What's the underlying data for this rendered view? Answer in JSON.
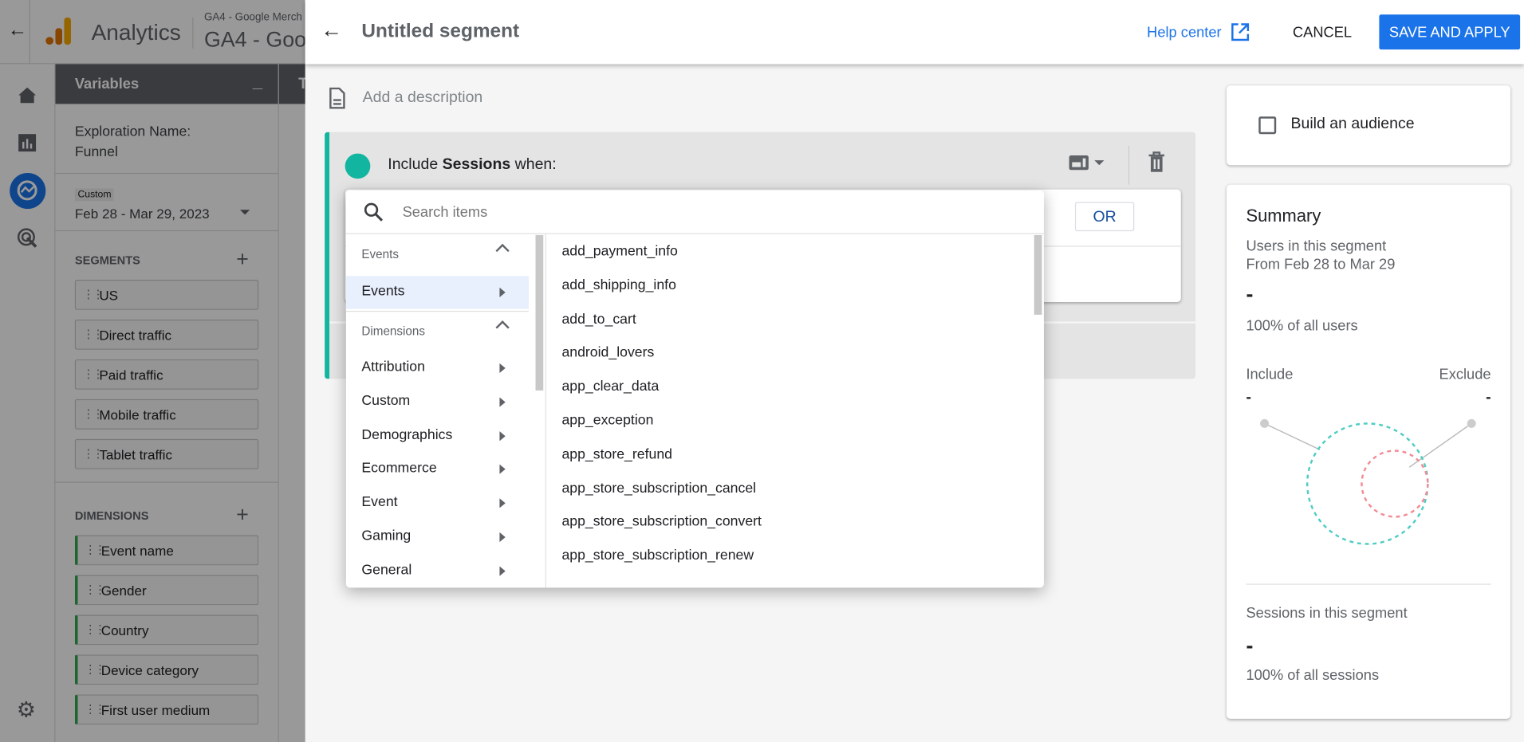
{
  "background_app": {
    "product": "Analytics",
    "account_small": "GA4 - Google Merch",
    "property": "GA4 - Goo",
    "variables_title": "Variables",
    "exploration_label": "Exploration Name:",
    "exploration_name": "Funnel",
    "date_chip": "Custom",
    "date_range": "Feb 28 - Mar 29, 2023",
    "segments_heading": "SEGMENTS",
    "segments": [
      "US",
      "Direct traffic",
      "Paid traffic",
      "Mobile traffic",
      "Tablet traffic"
    ],
    "dimensions_heading": "DIMENSIONS",
    "dimensions": [
      "Event name",
      "Gender",
      "Country",
      "Device category",
      "First user medium"
    ],
    "tab_letter": "T"
  },
  "panel": {
    "title": "Untitled segment",
    "help_center": "Help center",
    "cancel": "CANCEL",
    "save_apply": "SAVE AND APPLY",
    "description_placeholder": "Add a description",
    "include_prefix": "Include",
    "include_scope": "Sessions",
    "include_suffix": "when:",
    "or_button": "OR",
    "accent_color": "#12b5a0"
  },
  "picker": {
    "search_placeholder": "Search items",
    "events_header": "Events",
    "events_items": [
      "Events"
    ],
    "dimensions_header": "Dimensions",
    "dimension_categories": [
      "Attribution",
      "Custom",
      "Demographics",
      "Ecommerce",
      "Event",
      "Gaming",
      "General"
    ],
    "items": [
      "add_payment_info",
      "add_shipping_info",
      "add_to_cart",
      "android_lovers",
      "app_clear_data",
      "app_exception",
      "app_store_refund",
      "app_store_subscription_cancel",
      "app_store_subscription_convert",
      "app_store_subscription_renew"
    ]
  },
  "audience": {
    "label": "Build an audience",
    "checked": false
  },
  "summary": {
    "title": "Summary",
    "users_label": "Users in this segment",
    "users_range": "From Feb 28 to Mar 29",
    "users_value": "-",
    "users_pct": "100% of all users",
    "include_label": "Include",
    "exclude_label": "Exclude",
    "include_value": "-",
    "exclude_value": "-",
    "sessions_label": "Sessions in this segment",
    "sessions_value": "-",
    "sessions_pct": "100% of all sessions",
    "include_color": "#4ecdc4",
    "exclude_color": "#f28b96"
  }
}
